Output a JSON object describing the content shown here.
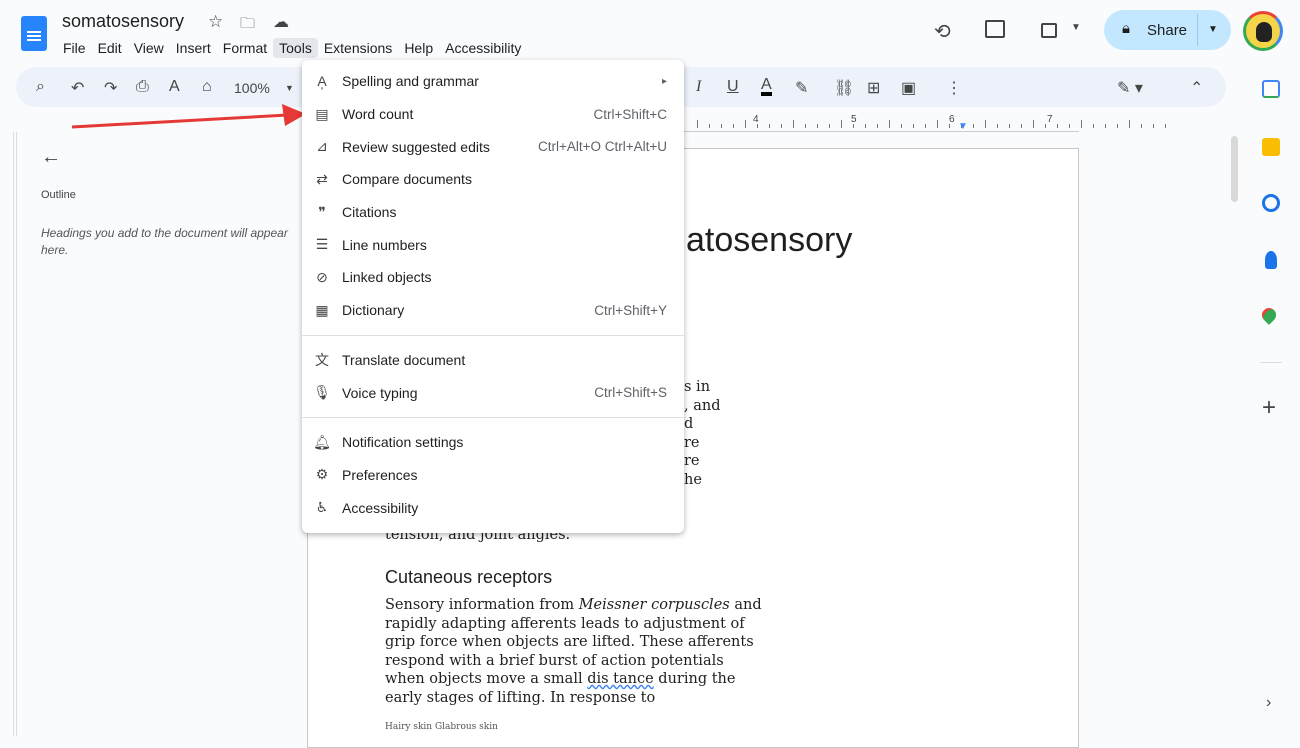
{
  "doc": {
    "title": "somatosensory"
  },
  "menubar": [
    "File",
    "Edit",
    "View",
    "Insert",
    "Format",
    "Tools",
    "Extensions",
    "Help",
    "Accessibility"
  ],
  "toolbar": {
    "zoom": "100%"
  },
  "share": {
    "label": "Share"
  },
  "ruler": [
    "4",
    "5",
    "6",
    "7"
  ],
  "outline": {
    "label": "Outline",
    "hint": "Headings you add to the document will appear here."
  },
  "tools_menu": {
    "groups": [
      [
        {
          "label": "Spelling and grammar",
          "icon": "spellcheck-icon",
          "shortcut": "▸"
        },
        {
          "label": "Word count",
          "icon": "word-count-icon",
          "shortcut": "Ctrl+Shift+C"
        },
        {
          "label": "Review suggested edits",
          "icon": "review-edits-icon",
          "shortcut": "Ctrl+Alt+O Ctrl+Alt+U"
        },
        {
          "label": "Compare documents",
          "icon": "compare-icon",
          "shortcut": ""
        },
        {
          "label": "Citations",
          "icon": "quote-icon",
          "shortcut": ""
        },
        {
          "label": "Line numbers",
          "icon": "line-numbers-icon",
          "shortcut": ""
        },
        {
          "label": "Linked objects",
          "icon": "link-objects-icon",
          "shortcut": ""
        },
        {
          "label": "Dictionary",
          "icon": "dictionary-icon",
          "shortcut": "Ctrl+Shift+Y"
        }
      ],
      [
        {
          "label": "Translate document",
          "icon": "translate-icon",
          "shortcut": ""
        },
        {
          "label": "Voice typing",
          "icon": "microphone-icon",
          "shortcut": "Ctrl+Shift+S"
        }
      ],
      [
        {
          "label": "Notification settings",
          "icon": "bell-icon",
          "shortcut": ""
        },
        {
          "label": "Preferences",
          "icon": "preferences-icon",
          "shortcut": ""
        },
        {
          "label": "Accessibility",
          "icon": "accessibility-icon",
          "shortcut": ""
        }
      ]
    ]
  },
  "page": {
    "title_fragment": "atosensory",
    "fragments": [
      "s in",
      ", and",
      "d",
      "re",
      "re",
      "he"
    ],
    "clipped_line": "tension, and joint angles.",
    "heading": "Cutaneous receptors",
    "para_lines": [
      "Sensory information from |Meissner corpuscles| and",
      "rapidly adapting afferents leads to adjustment of",
      "grip force when objects are lifted. These afferents",
      "respond with a brief burst of action potentials",
      "when objects move a small dis tance during the",
      "early stages of lifting. In response to"
    ],
    "caption": "Hairy skin Glabrous skin"
  },
  "colors": {
    "accent": "#c2e7ff",
    "arrow": "#e53935"
  }
}
